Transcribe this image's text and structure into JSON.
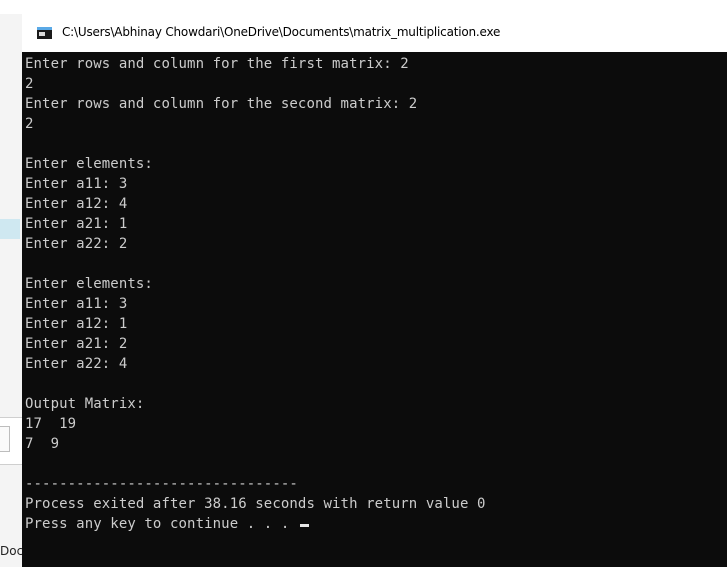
{
  "background": {
    "partial_label": "Doc"
  },
  "window": {
    "title": "C:\\Users\\Abhinay Chowdari\\OneDrive\\Documents\\matrix_multiplication.exe",
    "icon": "console-app-icon"
  },
  "console": {
    "lines": [
      "Enter rows and column for the first matrix: 2",
      "2",
      "Enter rows and column for the second matrix: 2",
      "2",
      "",
      "Enter elements:",
      "Enter a11: 3",
      "Enter a12: 4",
      "Enter a21: 1",
      "Enter a22: 2",
      "",
      "Enter elements:",
      "Enter a11: 3",
      "Enter a12: 1",
      "Enter a21: 2",
      "Enter a22: 4",
      "",
      "Output Matrix:",
      "17  19",
      "7  9",
      "",
      "--------------------------------",
      "Process exited after 38.16 seconds with return value 0",
      "Press any key to continue . . . "
    ]
  },
  "colors": {
    "console_background": "#0c0c0c",
    "console_text": "#cccccc",
    "title_bar": "#ffffff"
  }
}
